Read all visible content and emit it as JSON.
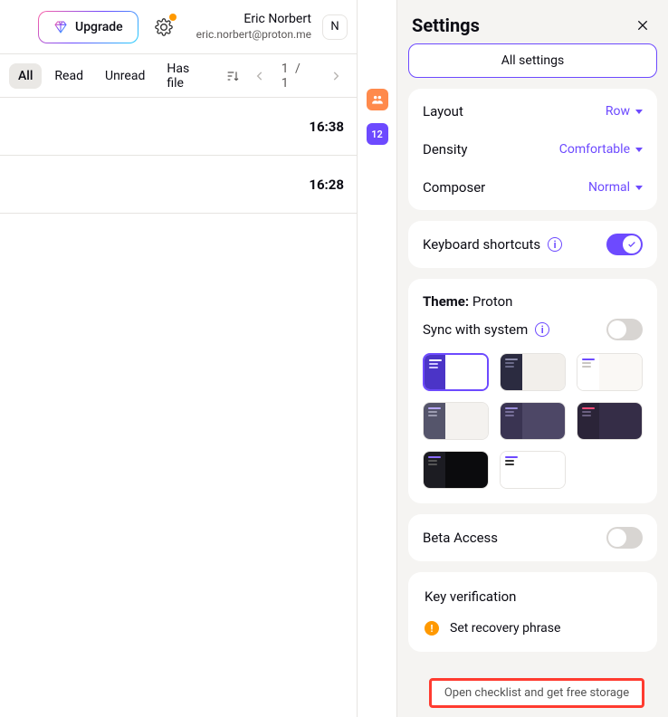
{
  "header": {
    "upgrade_label": "Upgrade",
    "user_name": "Eric Norbert",
    "user_email": "eric.norbert@proton.me",
    "avatar_initial": "N"
  },
  "filters": {
    "all": "All",
    "read": "Read",
    "unread": "Unread",
    "has_file": "Has file"
  },
  "paging": {
    "indicator": "1 / 1"
  },
  "messages": [
    {
      "time": "16:38"
    },
    {
      "time": "16:28"
    }
  ],
  "rail": {
    "calendar_day": "12"
  },
  "settings": {
    "title": "Settings",
    "all_button": "All settings",
    "layout_label": "Layout",
    "layout_value": "Row",
    "density_label": "Density",
    "density_value": "Comfortable",
    "composer_label": "Composer",
    "composer_value": "Normal",
    "shortcuts_label": "Keyboard shortcuts",
    "theme_label": "Theme:",
    "theme_value": "Proton",
    "sync_label": "Sync with system",
    "beta_label": "Beta Access",
    "keyver_title": "Key verification",
    "keyver_item": "Set recovery phrase",
    "checklist": "Open checklist and get free storage"
  }
}
